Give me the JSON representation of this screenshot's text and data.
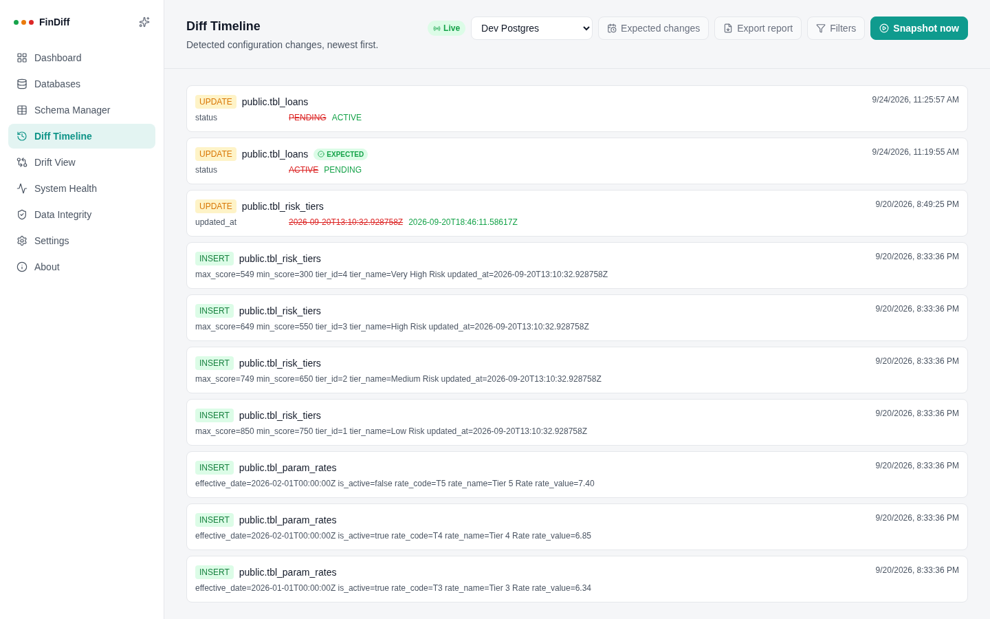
{
  "app": {
    "name": "FinDiff"
  },
  "sidebar": {
    "items": [
      {
        "label": "Dashboard",
        "selected": false
      },
      {
        "label": "Databases",
        "selected": false
      },
      {
        "label": "Schema Manager",
        "selected": false
      },
      {
        "label": "Diff Timeline",
        "selected": true
      },
      {
        "label": "Drift View",
        "selected": false
      },
      {
        "label": "System Health",
        "selected": false
      },
      {
        "label": "Data Integrity",
        "selected": false
      },
      {
        "label": "Settings",
        "selected": false
      },
      {
        "label": "About",
        "selected": false
      }
    ]
  },
  "header": {
    "title": "Diff Timeline",
    "subtitle": "Detected configuration changes, newest first.",
    "live": "Live",
    "database": "Dev Postgres",
    "buttons": [
      {
        "label": "Expected changes",
        "kind": "outline"
      },
      {
        "label": "Export report",
        "kind": "outline"
      },
      {
        "label": "Filters",
        "kind": "outline"
      },
      {
        "label": "Snapshot now",
        "kind": "primary"
      }
    ]
  },
  "changes": [
    {
      "kind": "update",
      "badge": "UPDATE",
      "table": "public.tbl_loans",
      "time": "9/24/2026, 11:25:57 AM",
      "field": "status",
      "old": "PENDING",
      "new": "ACTIVE",
      "expected": false
    },
    {
      "kind": "update",
      "badge": "UPDATE",
      "table": "public.tbl_loans",
      "time": "9/24/2026, 11:19:55 AM",
      "field": "status",
      "old": "ACTIVE",
      "new": "PENDING",
      "expected": true,
      "expected_label": "EXPECTED"
    },
    {
      "kind": "update",
      "badge": "UPDATE",
      "table": "public.tbl_risk_tiers",
      "time": "9/20/2026, 8:49:25 PM",
      "field": "updated_at",
      "old": "2026-09-20T13:10:32.928758Z",
      "new": "2026-09-20T18:46:11.58617Z",
      "expected": false
    },
    {
      "kind": "insert",
      "badge": "INSERT",
      "table": "public.tbl_risk_tiers",
      "time": "9/20/2026, 8:33:36 PM",
      "values": "max_score=549 min_score=300 tier_id=4 tier_name=Very High Risk updated_at=2026-09-20T13:10:32.928758Z",
      "expected": false
    },
    {
      "kind": "insert",
      "badge": "INSERT",
      "table": "public.tbl_risk_tiers",
      "time": "9/20/2026, 8:33:36 PM",
      "values": "max_score=649 min_score=550 tier_id=3 tier_name=High Risk updated_at=2026-09-20T13:10:32.928758Z",
      "expected": false
    },
    {
      "kind": "insert",
      "badge": "INSERT",
      "table": "public.tbl_risk_tiers",
      "time": "9/20/2026, 8:33:36 PM",
      "values": "max_score=749 min_score=650 tier_id=2 tier_name=Medium Risk updated_at=2026-09-20T13:10:32.928758Z",
      "expected": false
    },
    {
      "kind": "insert",
      "badge": "INSERT",
      "table": "public.tbl_risk_tiers",
      "time": "9/20/2026, 8:33:36 PM",
      "values": "max_score=850 min_score=750 tier_id=1 tier_name=Low Risk updated_at=2026-09-20T13:10:32.928758Z",
      "expected": false
    },
    {
      "kind": "insert",
      "badge": "INSERT",
      "table": "public.tbl_param_rates",
      "time": "9/20/2026, 8:33:36 PM",
      "values": "effective_date=2026-02-01T00:00:00Z is_active=false rate_code=T5 rate_name=Tier 5 Rate rate_value=7.40",
      "expected": false
    },
    {
      "kind": "insert",
      "badge": "INSERT",
      "table": "public.tbl_param_rates",
      "time": "9/20/2026, 8:33:36 PM",
      "values": "effective_date=2026-02-01T00:00:00Z is_active=true rate_code=T4 rate_name=Tier 4 Rate rate_value=6.85",
      "expected": false
    },
    {
      "kind": "insert",
      "badge": "INSERT",
      "table": "public.tbl_param_rates",
      "time": "9/20/2026, 8:33:36 PM",
      "values": "effective_date=2026-01-01T00:00:00Z is_active=true rate_code=T3 rate_name=Tier 3 Rate rate_value=6.34",
      "expected": false
    }
  ]
}
